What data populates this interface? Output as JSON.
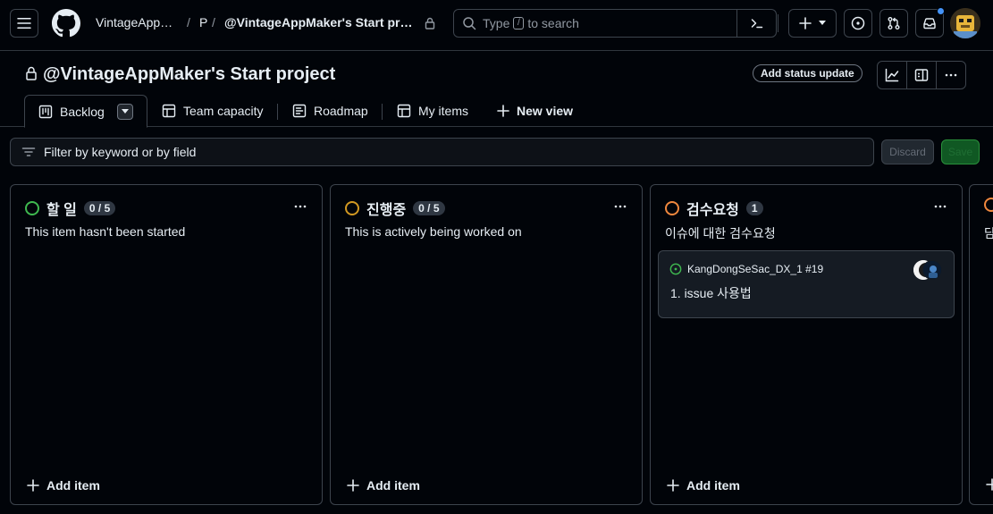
{
  "header": {
    "owner": "VintageApp…",
    "sep": "/",
    "project_letter": "P",
    "project_title": "@VintageAppMaker's Start proj…",
    "search": {
      "placeholder_before": "Type",
      "shortcut_key": "/",
      "placeholder_after": "to search"
    }
  },
  "project": {
    "title": "@VintageAppMaker's Start project",
    "status_button": "Add status update",
    "tabs": [
      {
        "label": "Backlog",
        "icon": "board-icon"
      },
      {
        "label": "Team capacity",
        "icon": "table-icon"
      },
      {
        "label": "Roadmap",
        "icon": "roadmap-icon"
      },
      {
        "label": "My items",
        "icon": "table-icon"
      }
    ],
    "new_view": "New view"
  },
  "filter": {
    "placeholder": "Filter by keyword or by field",
    "discard": "Discard",
    "save": "Save"
  },
  "columns": [
    {
      "name": "할 일",
      "count": "0 / 5",
      "description": "This item hasn't been started",
      "color": "#3fb950",
      "add_label": "Add item"
    },
    {
      "name": "진행중",
      "count": "0 / 5",
      "description": "This is actively being worked on",
      "color": "#d29922",
      "add_label": "Add item"
    },
    {
      "name": "검수요청",
      "count": "1",
      "description": "이슈에 대한 검수요청",
      "color": "#f0883e",
      "add_label": "Add item",
      "cards": [
        {
          "repo": "KangDongSeSac_DX_1 #19",
          "title": "1. issue 사용법",
          "status_color": "#3fb950"
        }
      ]
    },
    {
      "name": "",
      "description": "담",
      "color": "#f0883e"
    }
  ],
  "colors": {
    "background": "#010409",
    "border": "#3d444d",
    "text": "#e6edf3",
    "muted": "#9198a1",
    "accent_blue": "#4493f8"
  }
}
